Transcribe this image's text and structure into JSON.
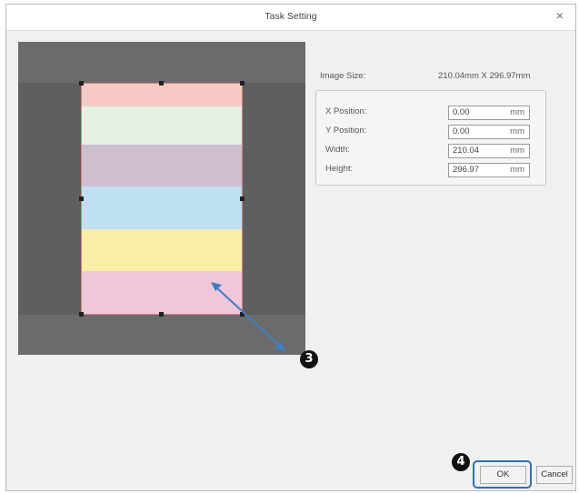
{
  "dialog": {
    "title": "Task Setting",
    "close_symbol": "×"
  },
  "info": {
    "image_size_label": "Image Size:",
    "image_size_value": "210.04mm X 296.97mm"
  },
  "fields": [
    {
      "label": "X Position:",
      "value": "0.00",
      "unit": "mm"
    },
    {
      "label": "Y Position:",
      "value": "0.00",
      "unit": "mm"
    },
    {
      "label": "Width:",
      "value": "210.04",
      "unit": "mm"
    },
    {
      "label": "Height:",
      "value": "296.97",
      "unit": "mm"
    }
  ],
  "preview": {
    "stripe_colors": [
      "#f6c9c4",
      "#e5f1e5",
      "#cdbfce",
      "#bfe0f3",
      "#f9efa7",
      "#f0c6da"
    ],
    "arrow_color": "#3d7fc4"
  },
  "callouts": {
    "step3": "3",
    "step4": "4"
  },
  "buttons": {
    "ok": "OK",
    "cancel": "Cancel"
  },
  "colors": {
    "highlight": "#2e6fb3"
  }
}
